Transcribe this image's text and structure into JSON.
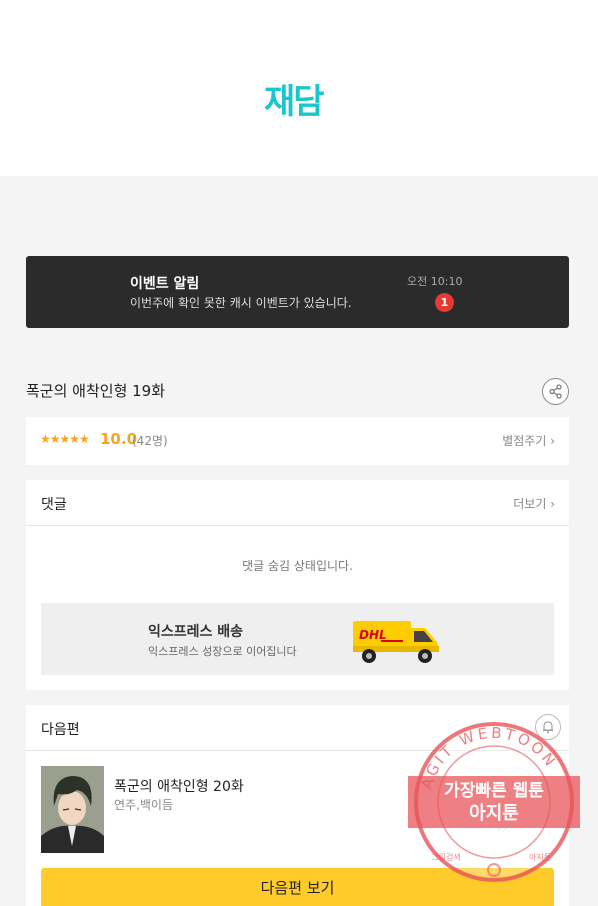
{
  "header": {
    "logo": "재담"
  },
  "banner": {
    "title": "이벤트 알림",
    "subtitle": "이번주에 확인 못한 캐시 이벤트가 있습니다.",
    "time": "오전 10:10",
    "badge": "1"
  },
  "episode": {
    "title": "폭군의 애착인형 19화"
  },
  "rating": {
    "stars": "★★★★★",
    "score": "10.0",
    "count": "(42명)",
    "rate_link": "별점주기 ›"
  },
  "comments": {
    "label": "댓글",
    "more": "더보기 ›",
    "empty_text": "댓글 숨김 상태입니다."
  },
  "ad": {
    "title": "익스프레스 배송",
    "subtitle": "익스프레스 성장으로 이어집니다",
    "truck_logo": "DHL"
  },
  "next": {
    "label": "다음편",
    "title": "폭군의 애착인형 20화",
    "author": "연주,백이듬",
    "button_label": "다음편 보기"
  },
  "watermark": {
    "ring_text": "AGIT WEBTOON",
    "line1": "가장빠른 웹툰",
    "line2": "아지툰",
    "bottom_left": "그림검색",
    "bottom_right": "아지툰"
  },
  "colors": {
    "brand": "#19c6cc",
    "star": "#f7a51d",
    "cta": "#ffcb2b",
    "badge": "#e53935",
    "watermark": "#e8545a"
  }
}
